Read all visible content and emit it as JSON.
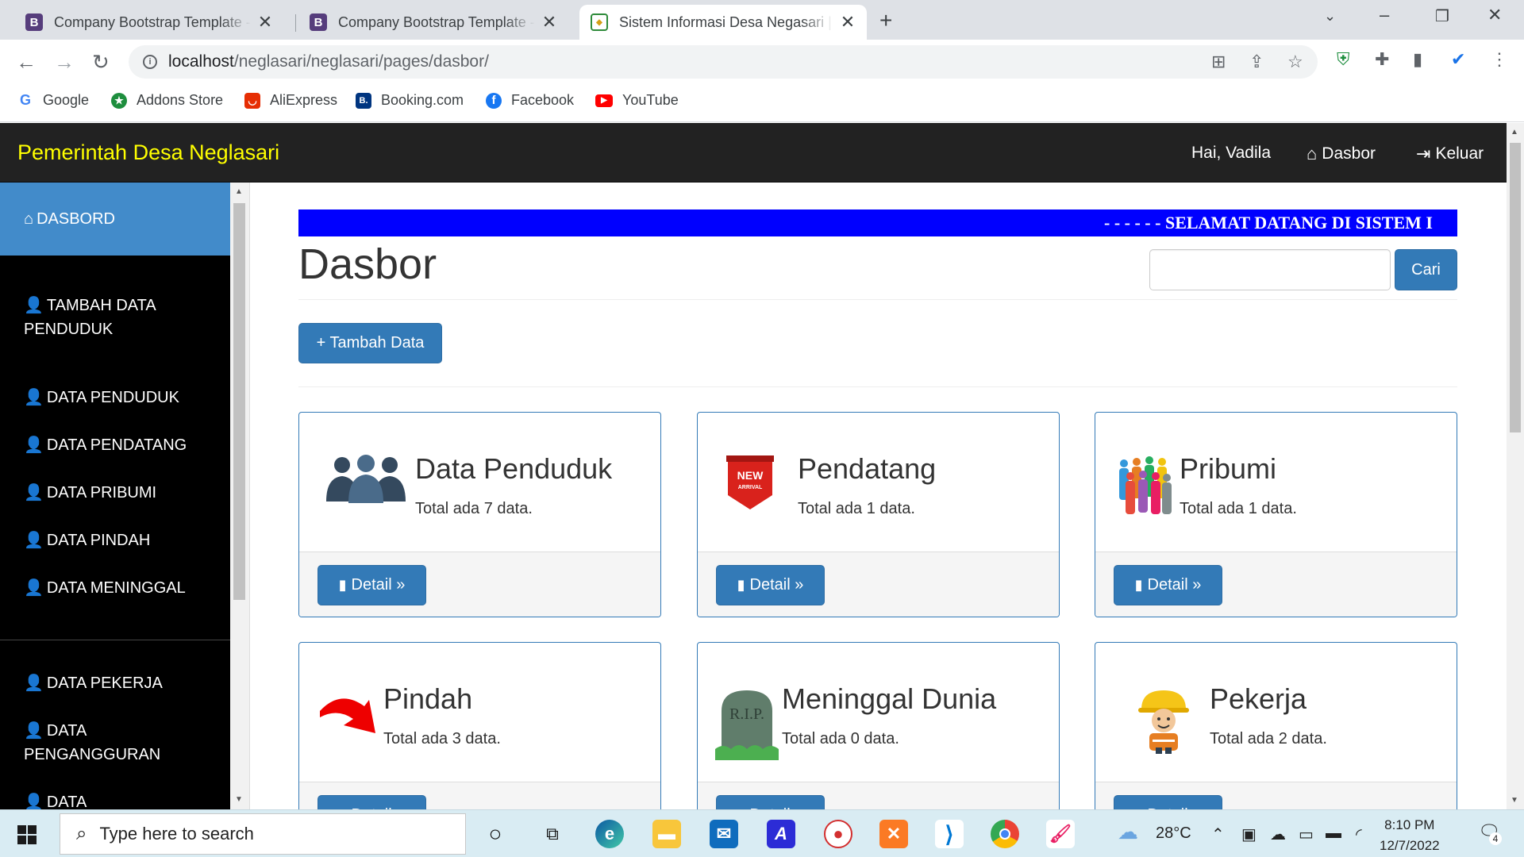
{
  "browser": {
    "tabs": [
      {
        "title": "Company Bootstrap Template - I",
        "favicon": "B"
      },
      {
        "title": "Company Bootstrap Template - I",
        "favicon": "B"
      },
      {
        "title": "Sistem Informasi Desa Negasari |",
        "favicon": "emblem"
      }
    ],
    "url_host": "localhost",
    "url_path": "/neglasari/neglasari/pages/dasbor/",
    "bookmarks": [
      {
        "label": "Google",
        "color": "#4285f4",
        "glyph": "G"
      },
      {
        "label": "Addons Store",
        "color": "#1e8e3e",
        "glyph": "★"
      },
      {
        "label": "AliExpress",
        "color": "#e62e04",
        "glyph": "◡"
      },
      {
        "label": "Booking.com",
        "color": "#003580",
        "glyph": "B."
      },
      {
        "label": "Facebook",
        "color": "#1877f2",
        "glyph": "f"
      },
      {
        "label": "YouTube",
        "color": "#ff0000",
        "glyph": "▶"
      }
    ]
  },
  "navbar": {
    "brand": "Pemerintah Desa Neglasari",
    "greeting": "Hai, Vadila",
    "dasbor": "Dasbor",
    "keluar": "Keluar"
  },
  "sidebar": {
    "items": [
      {
        "label": "DASBORD",
        "icon": "home-icon"
      },
      {
        "label": "TAMBAH DATA PENDUDUK",
        "icon": "user-icon"
      },
      {
        "label": "DATA PENDUDUK",
        "icon": "user-icon"
      },
      {
        "label": "DATA PENDATANG",
        "icon": "user-icon"
      },
      {
        "label": "DATA PRIBUMI",
        "icon": "user-icon"
      },
      {
        "label": "DATA PINDAH",
        "icon": "user-icon"
      },
      {
        "label": "DATA MENINGGAL",
        "icon": "user-icon"
      },
      {
        "label": "DATA PEKERJA",
        "icon": "user-icon"
      },
      {
        "label": "DATA PENGANGGURAN",
        "icon": "user-icon"
      },
      {
        "label": "DATA",
        "icon": "user-icon"
      }
    ]
  },
  "main": {
    "marquee": "- - - - - - SELAMAT DATANG DI SISTEM I",
    "heading": "Dasbor",
    "search_button": "Cari",
    "add_button": "+ Tambah Data",
    "detail_label": "Detail »",
    "cards": [
      {
        "title": "Data Penduduk",
        "subtitle": "Total ada 7 data.",
        "icon": "people-group-icon"
      },
      {
        "title": "Pendatang",
        "subtitle": "Total ada 1 data.",
        "icon": "new-arrival-badge-icon",
        "badge_text": "NEW ARRIVAL"
      },
      {
        "title": "Pribumi",
        "subtitle": "Total ada 1 data.",
        "icon": "colorful-crowd-icon"
      },
      {
        "title": "Pindah",
        "subtitle": "Total ada 3 data.",
        "icon": "red-curved-arrow-icon"
      },
      {
        "title": "Meninggal Dunia",
        "subtitle": "Total ada 0 data.",
        "icon": "rip-tombstone-icon",
        "badge_text": "R.I.P."
      },
      {
        "title": "Pekerja",
        "subtitle": "Total ada 2 data.",
        "icon": "worker-helmet-icon"
      }
    ]
  },
  "taskbar": {
    "search_placeholder": "Type here to search",
    "weather": "28°C",
    "time": "8:10 PM",
    "date": "12/7/2022",
    "notification_count": "4"
  },
  "colors": {
    "brand_yellow": "#ffff00",
    "primary": "#337ab7",
    "sidebar_active": "#428bca",
    "marquee_bg": "#0000ff"
  }
}
